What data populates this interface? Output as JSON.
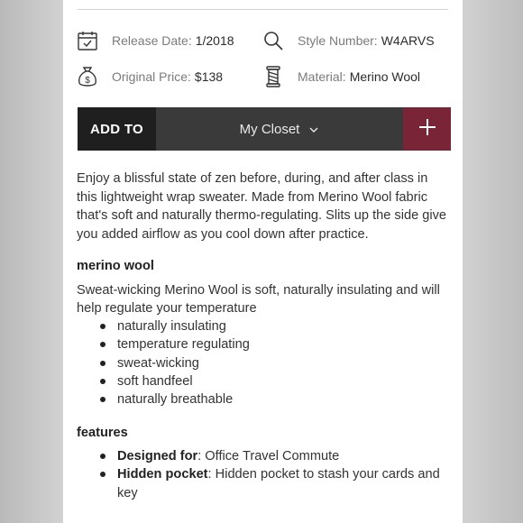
{
  "meta": {
    "release": {
      "label": "Release Date:",
      "value": "1/2018",
      "icon": "calendar-icon"
    },
    "style": {
      "label": "Style Number:",
      "value": "W4ARVS",
      "icon": "search-icon"
    },
    "price": {
      "label": "Original Price:",
      "value": "$138",
      "icon": "money-bag-icon"
    },
    "material": {
      "label": "Material:",
      "value": "Merino Wool",
      "icon": "fabric-spool-icon"
    }
  },
  "addbar": {
    "add_to": "ADD TO",
    "closet": "My Closet",
    "plus": "+",
    "accent": "#7a2437"
  },
  "description": "Enjoy a blissful state of zen before, during, and after class in this lightweight wrap sweater. Made from Merino Wool fabric that's soft and naturally thermo-regulating. Slits up the side give you added airflow as you cool down after practice.",
  "merino": {
    "heading": "merino wool",
    "text": "Sweat-wicking Merino Wool is soft, naturally insulating and will help regulate your temperature",
    "bullets": [
      "naturally insulating",
      "temperature regulating",
      "sweat-wicking",
      "soft handfeel",
      "naturally breathable"
    ]
  },
  "features": {
    "heading": "features",
    "items": [
      {
        "label": "Designed for",
        "text": ": Office Travel Commute"
      },
      {
        "label": "Hidden pocket",
        "text": ": Hidden pocket to stash your cards and key"
      }
    ]
  }
}
